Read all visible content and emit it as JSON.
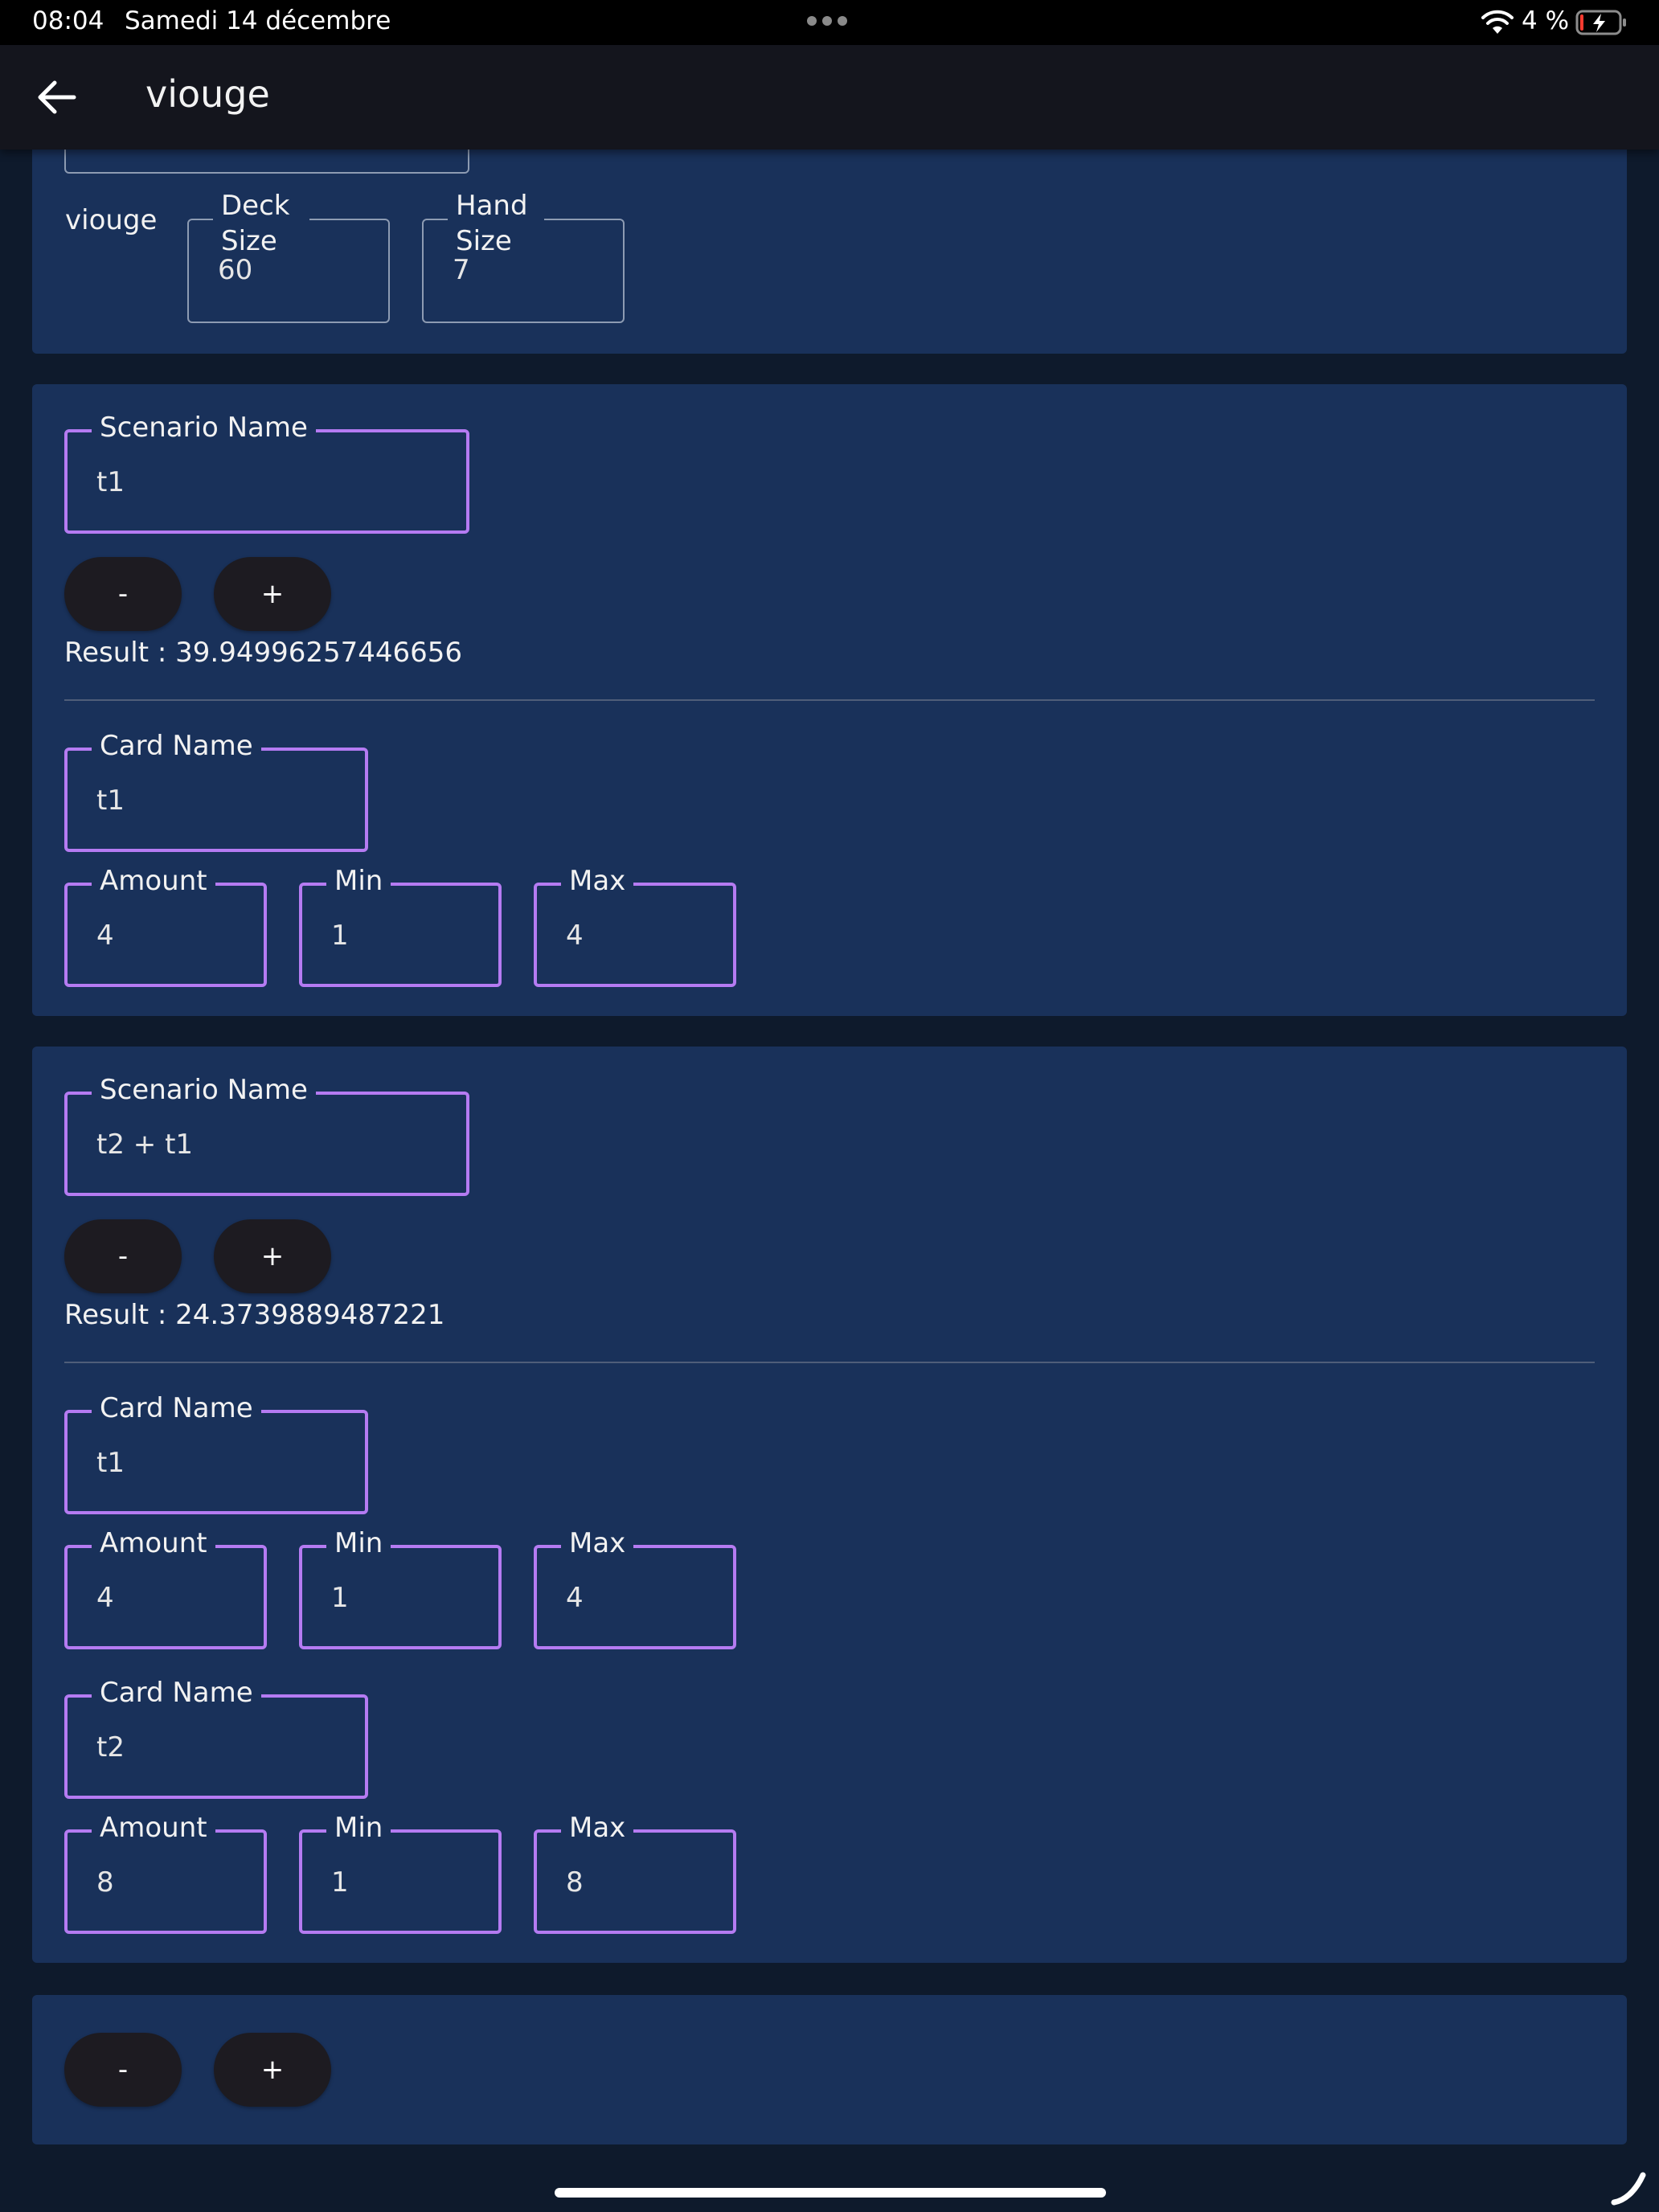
{
  "status_bar": {
    "time": "08:04",
    "date": "Samedi 14 décembre",
    "battery_percent": "4 %"
  },
  "app_bar": {
    "title": "viouge"
  },
  "deck": {
    "name": "viouge",
    "deck_size_label": "Deck Size",
    "deck_size_value": "60",
    "hand_size_label": "Hand Size",
    "hand_size_value": "7"
  },
  "scenarios": [
    {
      "name_label": "Scenario Name",
      "name_value": "t1",
      "minus_label": "-",
      "plus_label": "+",
      "result": "Result : 39.94996257446656",
      "cards": [
        {
          "card_label": "Card Name",
          "card_value": "t1",
          "amount_label": "Amount",
          "amount_value": "4",
          "min_label": "Min",
          "min_value": "1",
          "max_label": "Max",
          "max_value": "4"
        }
      ]
    },
    {
      "name_label": "Scenario Name",
      "name_value": "t2 + t1",
      "minus_label": "-",
      "plus_label": "+",
      "result": "Result : 24.3739889487221",
      "cards": [
        {
          "card_label": "Card Name",
          "card_value": "t1",
          "amount_label": "Amount",
          "amount_value": "4",
          "min_label": "Min",
          "min_value": "1",
          "max_label": "Max",
          "max_value": "4"
        },
        {
          "card_label": "Card Name",
          "card_value": "t2",
          "amount_label": "Amount",
          "amount_value": "8",
          "min_label": "Min",
          "min_value": "1",
          "max_label": "Max",
          "max_value": "8"
        }
      ]
    }
  ],
  "footer_controls": {
    "minus_label": "-",
    "plus_label": "+"
  },
  "colors": {
    "background": "#0e1a2c",
    "card": "#19315a",
    "app_bar": "#14151d",
    "field_border_focus": "#b57bf2",
    "field_border_default": "#8d9bb2",
    "pill_button": "#1d1b21"
  }
}
